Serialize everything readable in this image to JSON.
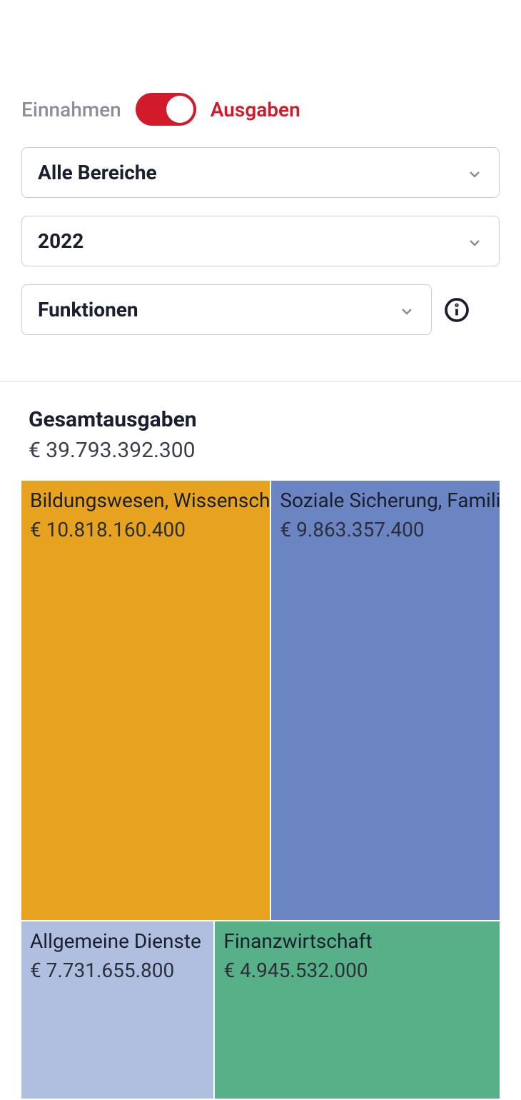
{
  "toggle": {
    "left": "Einnahmen",
    "right": "Ausgaben",
    "active": "right"
  },
  "selects": {
    "area": "Alle Bereiche",
    "year": "2022",
    "view": "Funktionen"
  },
  "totals": {
    "label": "Gesamtausgaben",
    "value": "€ 39.793.392.300"
  },
  "colors": {
    "orange": "#e7a21f",
    "blue": "#6b84c2",
    "lightblue": "#b0bfe0",
    "green": "#57b088",
    "accent": "#d11a2a"
  },
  "chart_data": {
    "type": "treemap",
    "title": "Gesamtausgaben",
    "total": 39793392300,
    "currency": "EUR",
    "series": [
      {
        "name": "Bildungswesen, Wissenschaft",
        "value": 10818160400,
        "color": "#e7a21f"
      },
      {
        "name": "Soziale Sicherung, Familie",
        "value": 9863357400,
        "color": "#6b84c2"
      },
      {
        "name": "Allgemeine Dienste",
        "value": 7731655800,
        "color": "#b0bfe0"
      },
      {
        "name": "Finanzwirtschaft",
        "value": 4945532000,
        "color": "#57b088"
      }
    ]
  },
  "cells": {
    "0": {
      "label": "Bildungswesen, Wissenschaft",
      "value": "€ 10.818.160.400"
    },
    "1": {
      "label": "Soziale Sicherung, Familie",
      "value": "€ 9.863.357.400"
    },
    "2": {
      "label": "Allgemeine Dienste",
      "value": "€ 7.731.655.800"
    },
    "3": {
      "label": "Finanzwirtschaft",
      "value": "€ 4.945.532.000"
    }
  }
}
